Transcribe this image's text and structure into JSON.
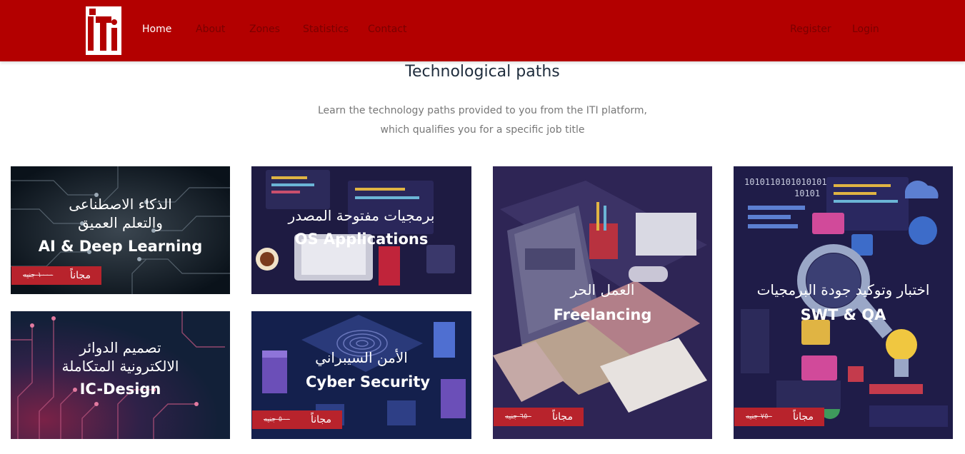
{
  "nav": {
    "logo_alt": "ITI",
    "links": [
      "Home",
      "About",
      "Zones",
      "Statistics",
      "Contact"
    ],
    "right_links": [
      "Register",
      "Login"
    ]
  },
  "section": {
    "title": "Technological paths",
    "subtitle_line1": "Learn the technology paths provided to you from the ITI platform,",
    "subtitle_line2": "which qualifies you for a specific job title"
  },
  "cards": [
    {
      "arabic_line1": "الذكاء الاصطناعى",
      "arabic_line2": "والتعلم العميق",
      "english": "AI  & Deep Learning",
      "free": "مجاناً",
      "old_price": "١٠٠٠ جنيه"
    },
    {
      "arabic_line1": "برمجيات مفتوحة المصدر",
      "english": "OS Applications"
    },
    {
      "arabic_line1": "العمل الحر",
      "english": "Freelancing",
      "free": "مجاناً",
      "old_price": "٦٥٠ جنيه"
    },
    {
      "arabic_line1": "اختبار وتوكيد جودة البرمجيات",
      "english": "SWT & QA",
      "free": "مجاناً",
      "old_price": "٧٥٠ جنيه",
      "binary_line1": "1010110101010101",
      "binary_line2": "10101"
    },
    {
      "arabic_line1": "تصميم الدوائر",
      "arabic_line2": "الالكترونية المتكاملة",
      "english": "IC-Design"
    },
    {
      "arabic_line1": "الأمن السيبراني",
      "english": "Cyber Security",
      "free": "مجاناً",
      "old_price": "٥٠٠ جنيه"
    }
  ],
  "colors": {
    "navbar": "#b30000",
    "price_tag": "#b8232c",
    "title": "#1f2d3d",
    "subtitle": "#777777"
  }
}
